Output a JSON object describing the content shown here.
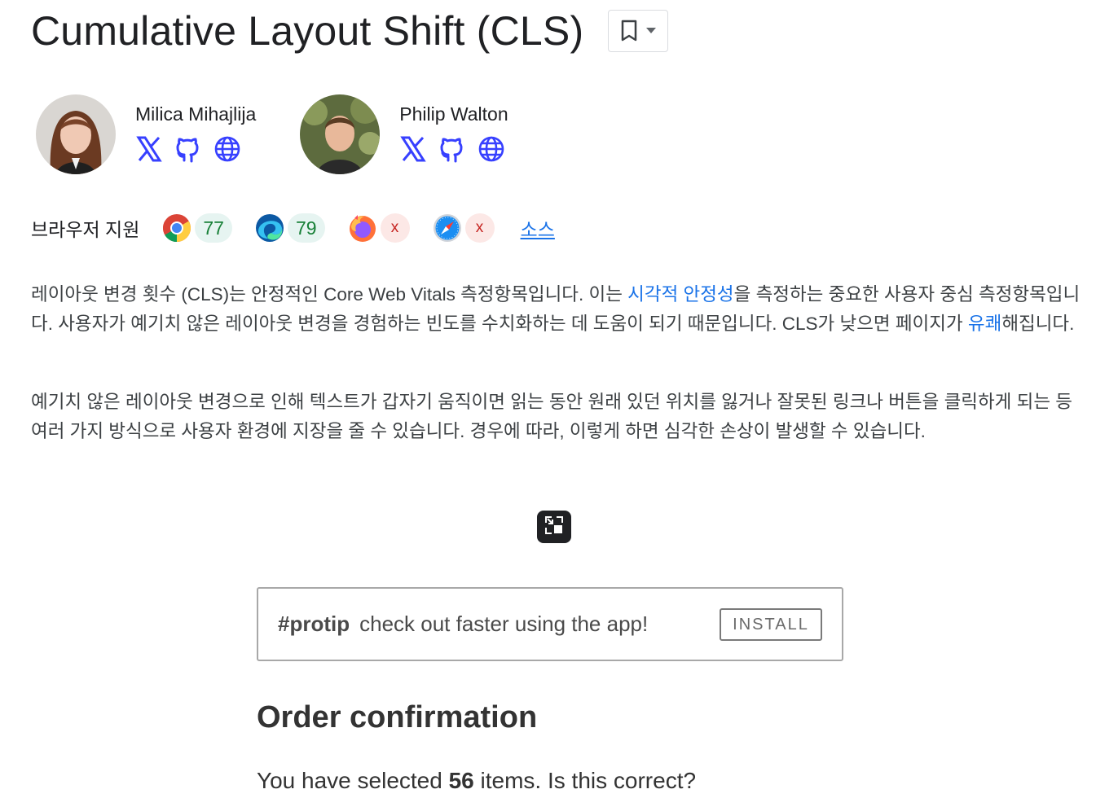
{
  "page": {
    "title": "Cumulative Layout Shift (CLS)"
  },
  "bookmark": {
    "icon": "bookmark-icon",
    "menu_icon": "caret-down-icon"
  },
  "authors": [
    {
      "name": "Milica Mihajlija",
      "links": [
        "x-icon",
        "github-icon",
        "globe-icon"
      ]
    },
    {
      "name": "Philip Walton",
      "links": [
        "x-icon",
        "github-icon",
        "globe-icon"
      ]
    }
  ],
  "browser_support": {
    "label": "브라우저 지원",
    "browsers": [
      {
        "icon": "chrome-icon",
        "version": "77",
        "supported": true
      },
      {
        "icon": "edge-icon",
        "version": "79",
        "supported": true
      },
      {
        "icon": "firefox-icon",
        "version": "x",
        "supported": false
      },
      {
        "icon": "safari-icon",
        "version": "x",
        "supported": false
      }
    ],
    "source_link": "소스"
  },
  "paragraphs": {
    "p1_a": "레이아웃 변경 횟수 (CLS)는 안정적인 Core Web Vitals 측정항목입니다. 이는 ",
    "p1_link1": "시각적 안정성",
    "p1_b": "을 측정하는 중요한 사용자 중심 측정항목입니다. 사용자가 예기치 않은 레이아웃 변경을 경험하는 빈도를 수치화하는 데 도움이 되기 때문입니다. CLS가 낮으면 페이지가 ",
    "p1_link2": "유쾌",
    "p1_c": "해집니다.",
    "p2": "예기치 않은 레이아웃 변경으로 인해 텍스트가 갑자기 움직이면 읽는 동안 원래 있던 위치를 잃거나 잘못된 링크나 버튼을 클릭하게 되는 등 여러 가지 방식으로 사용자 환경에 지장을 줄 수 있습니다. 경우에 따라, 이렇게 하면 심각한 손상이 발생할 수 있습니다."
  },
  "demo": {
    "fullscreen_icon": "exit-fullscreen-icon",
    "banner_protip": "#protip",
    "banner_text": "check out faster using the app!",
    "install_label": "INSTALL",
    "order_title": "Order confirmation",
    "order_prefix": "You have selected ",
    "order_count": "56",
    "order_suffix": " items. Is this correct?"
  },
  "colors": {
    "link": "#1a73e8",
    "supported_badge": "#e6f4f1",
    "unsupported_badge": "#fce8e6"
  }
}
